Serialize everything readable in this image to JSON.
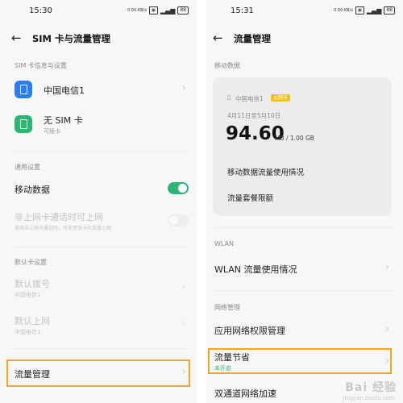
{
  "left": {
    "status_time": "15:30",
    "status_icons": "0.00 KB/s",
    "battery": "88",
    "title": "SIM 卡与流量管理",
    "section_sim": "SIM 卡信息与设置",
    "sim1_label": "中国电信1",
    "sim2_label": "无 SIM 卡",
    "sim2_sub": "可插卡",
    "section_general": "通用设置",
    "mobile_data": "移动数据",
    "non_internet_label": "非上网卡通话时可上网",
    "non_internet_sub": "使用非上网卡通话时，可使用该卡的流量上网",
    "section_default": "默认卡设置",
    "default_dial": "默认拨号",
    "default_dial_value": "中国电信1",
    "default_internet": "默认上网",
    "default_internet_value": "中国电信1",
    "traffic_mgmt": "流量管理"
  },
  "right": {
    "status_time": "15:31",
    "status_icons": "0.00 KB/s",
    "battery": "88",
    "title": "流量管理",
    "section_mobile": "移动数据",
    "card_carrier": "中国电信1",
    "card_badge": "上网卡",
    "card_dates": "4月11日至5月10日",
    "card_usage": "94.60",
    "card_usage_unit": "MB / 1.00 GB",
    "usage_detail": "移动数据流量使用情况",
    "plan_quota": "流量套餐限额",
    "section_wlan": "WLAN",
    "wlan_usage": "WLAN 流量使用情况",
    "section_network": "网络管理",
    "app_permissions": "应用网络权限管理",
    "data_saver": "流量节省",
    "data_saver_status": "未开启",
    "dual_channel": "双通道网络加速"
  },
  "watermark": "Bai 经验",
  "watermark_url": "jingyan.baidu.com",
  "colors": {
    "accent_green": "#2bb673",
    "sim1_blue": "#2a7ef0",
    "highlight": "#f5a623",
    "badge_yellow": "#f0c419"
  }
}
